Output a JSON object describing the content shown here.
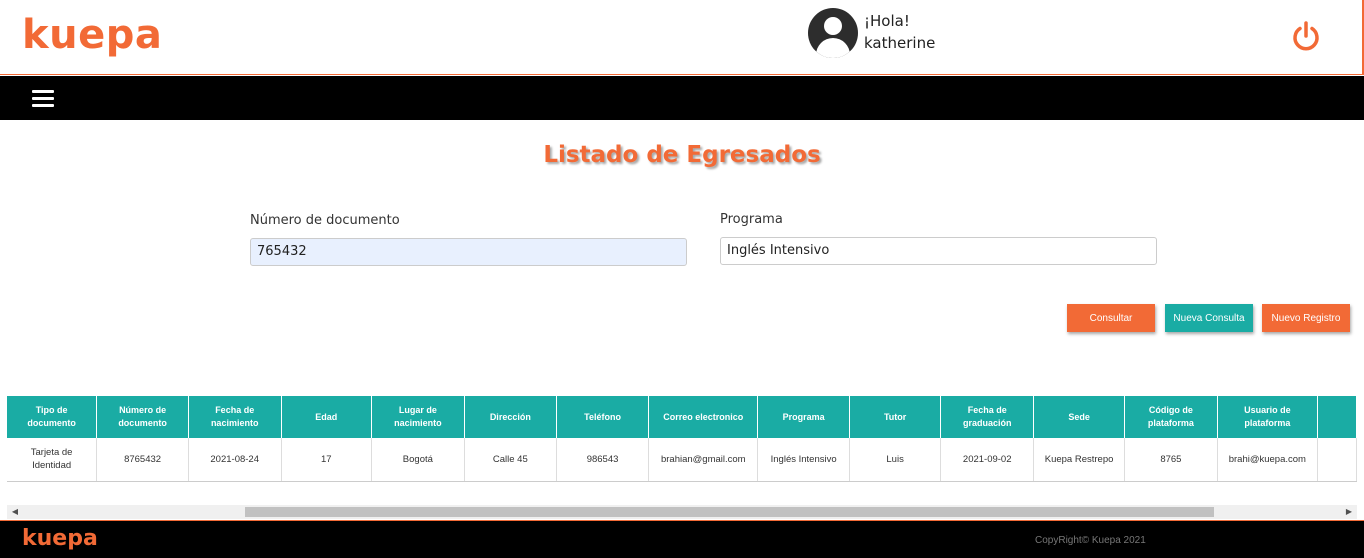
{
  "header": {
    "brand": "kuepa",
    "greeting": "¡Hola!",
    "username": "katherine"
  },
  "page": {
    "title": "Listado de Egresados"
  },
  "form": {
    "document_label": "Número de documento",
    "document_value": "765432",
    "program_label": "Programa",
    "program_value": "Inglés Intensivo"
  },
  "buttons": {
    "consultar": "Consultar",
    "nueva_consulta": "Nueva Consulta",
    "nuevo_registro": "Nuevo Registro"
  },
  "table": {
    "headers": [
      "Tipo de documento",
      "Número de documento",
      "Fecha de nacimiento",
      "Edad",
      "Lugar de nacimiento",
      "Dirección",
      "Teléfono",
      "Correo electronico",
      "Programa",
      "Tutor",
      "Fecha de graduación",
      "Sede",
      "Código de plataforma",
      "Usuario de plataforma",
      ""
    ],
    "rows": [
      [
        "Tarjeta de Identidad",
        "8765432",
        "2021-08-24",
        "17",
        "Bogotá",
        "Calle 45",
        "986543",
        "brahian@gmail.com",
        "Inglés Intensivo",
        "Luis",
        "2021-09-02",
        "Kuepa Restrepo",
        "8765",
        "brahi@kuepa.com",
        ""
      ]
    ]
  },
  "footer": {
    "brand": "kuepa",
    "copyright": "CopyRight© Kuepa 2021"
  },
  "colors": {
    "accent": "#f26a36",
    "teal": "#1aaca4",
    "bar": "#000000"
  }
}
